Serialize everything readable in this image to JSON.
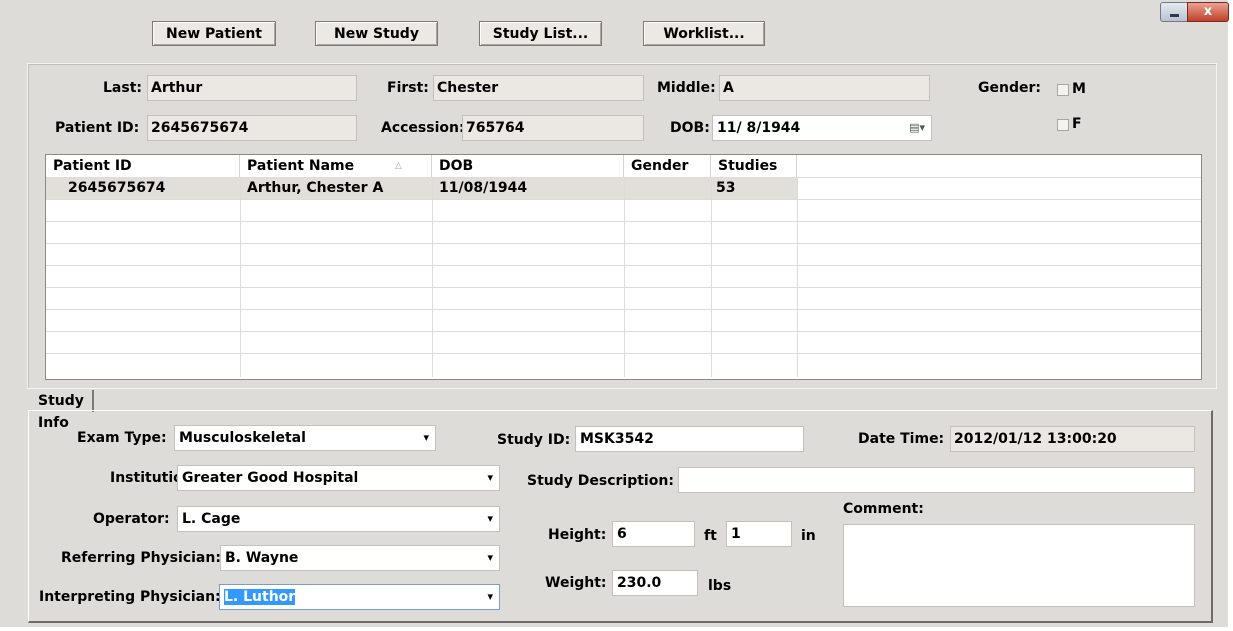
{
  "toolbar": {
    "new_patient": "New Patient",
    "new_study": "New Study",
    "study_list": "Study List...",
    "worklist": "Worklist..."
  },
  "window": {
    "close_glyph": "x"
  },
  "patient": {
    "last_label": "Last:",
    "last_value": "Arthur",
    "first_label": "First:",
    "first_value": "Chester",
    "middle_label": "Middle:",
    "middle_value": "A",
    "gender_label": "Gender:",
    "gender_m": "M",
    "gender_f": "F",
    "patient_id_label": "Patient ID:",
    "patient_id_value": "2645675674",
    "accession_label": "Accession:",
    "accession_value": "765764",
    "dob_label": "DOB:",
    "dob_value": "11/ 8/1944"
  },
  "grid": {
    "columns": [
      "Patient ID",
      "Patient Name",
      "DOB",
      "Gender",
      "Studies"
    ],
    "rows": [
      {
        "patient_id": "2645675674",
        "patient_name": "Arthur, Chester A",
        "dob": "11/08/1944",
        "gender": "",
        "studies": "53"
      }
    ]
  },
  "tabs": {
    "study_info": "Study Info"
  },
  "study": {
    "exam_type_label": "Exam Type:",
    "exam_type_value": "Musculoskeletal",
    "study_id_label": "Study ID:",
    "study_id_value": "MSK3542",
    "datetime_label": "Date Time:",
    "datetime_value": "2012/01/12 13:00:20",
    "institution_label": "Institution:",
    "institution_value": "Greater Good Hospital",
    "study_desc_label": "Study Description:",
    "study_desc_value": "",
    "operator_label": "Operator:",
    "operator_value": "L. Cage",
    "comment_label": "Comment:",
    "comment_value": "",
    "height_label": "Height:",
    "height_ft": "6",
    "ft_label": "ft",
    "height_in": "1",
    "in_label": "in",
    "referring_label": "Referring Physician:",
    "referring_value": "B. Wayne",
    "weight_label": "Weight:",
    "weight_value": "230.0",
    "lbs_label": "lbs",
    "interpreting_label": "Interpreting Physician:",
    "interpreting_value": "L. Luthor"
  }
}
